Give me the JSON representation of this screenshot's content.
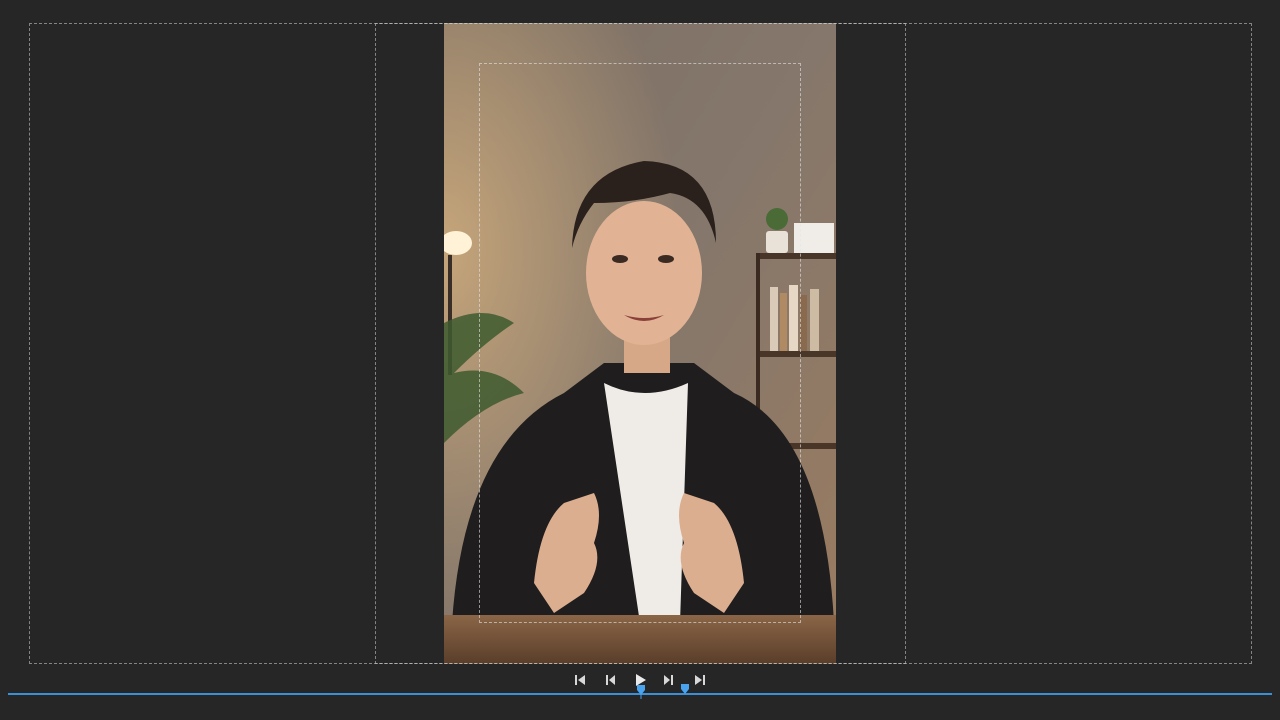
{
  "program_monitor": {
    "guides": {
      "title_safe": "title-safe-guide",
      "action_safe": "action-safe-guide",
      "inner_safe": "inner-safe-guide"
    },
    "frame": {
      "subject": "man-speaking-to-camera",
      "background_color": "#6f6258",
      "accent_lamp_color": "#ffd9a0"
    }
  },
  "transport": {
    "buttons": [
      {
        "name": "go-to-in-point-button",
        "icon": "go-to-in-icon"
      },
      {
        "name": "step-back-button",
        "icon": "step-back-icon"
      },
      {
        "name": "play-button",
        "icon": "play-icon"
      },
      {
        "name": "step-forward-button",
        "icon": "step-forward-icon"
      },
      {
        "name": "go-to-out-point-button",
        "icon": "go-to-out-icon"
      }
    ]
  },
  "timeline": {
    "bar_color": "#3b8fd6",
    "playhead_color": "#4aa3ef",
    "marker_color": "#4aa3ef"
  }
}
